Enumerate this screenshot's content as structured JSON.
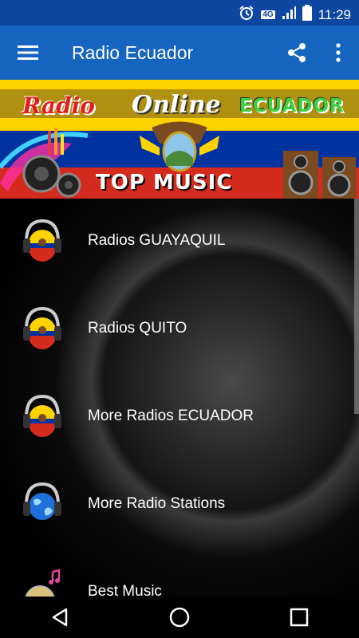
{
  "status": {
    "network": "4G",
    "time": "11:29"
  },
  "appbar": {
    "title": "Radio Ecuador"
  },
  "banner": {
    "line1_left": "Radio",
    "line1_mid": "Online",
    "line1_right": "ECUADOR",
    "tagline": "TOP MUSIC"
  },
  "list": {
    "items": [
      {
        "label": "Radios GUAYAQUIL",
        "icon": "ecuador-flag-headphones-icon"
      },
      {
        "label": "Radios QUITO",
        "icon": "ecuador-flag-headphones-icon"
      },
      {
        "label": "More Radios ECUADOR",
        "icon": "ecuador-flag-headphones-icon"
      },
      {
        "label": "More Radio Stations",
        "icon": "globe-headphones-icon"
      },
      {
        "label": "Best Music",
        "icon": "cd-music-icon"
      }
    ]
  },
  "colors": {
    "statusbar": "#0D47A1",
    "appbar": "#1565C0",
    "flag_yellow": "#FFD200",
    "flag_blue": "#0033A0",
    "flag_red": "#D52B1E"
  }
}
